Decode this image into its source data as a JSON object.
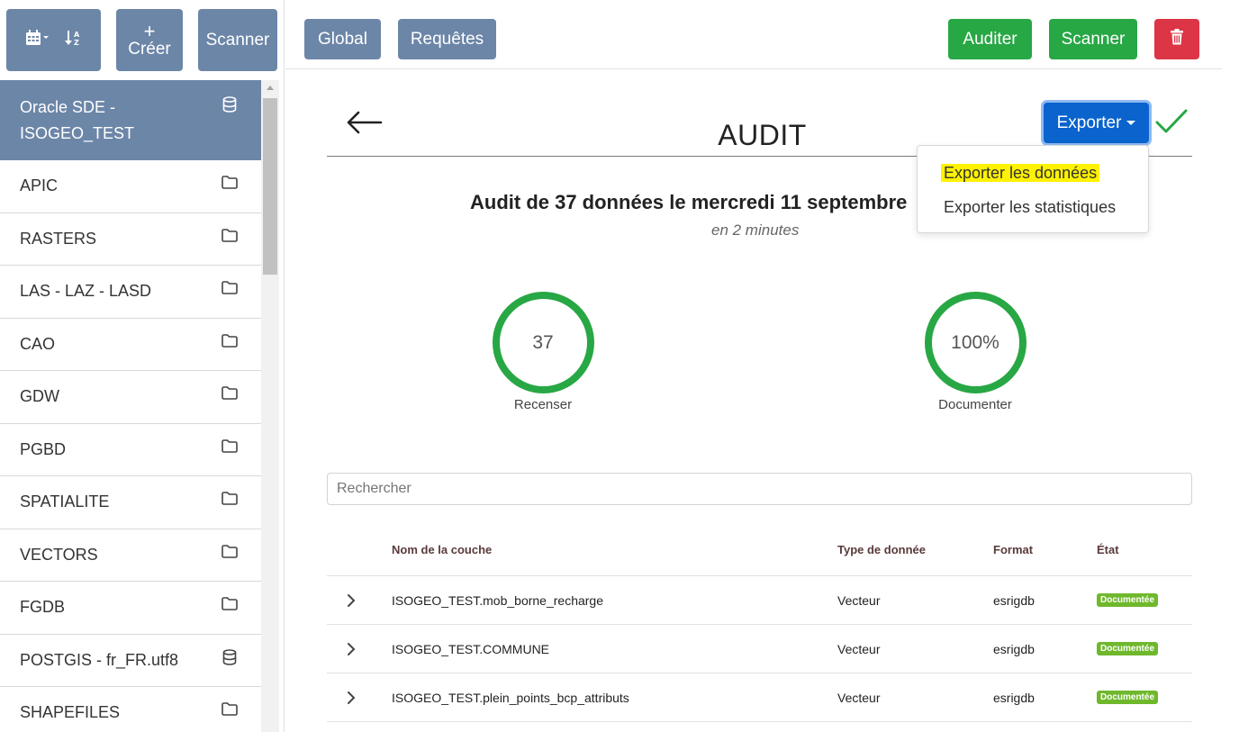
{
  "sidebar": {
    "toolbar": {
      "create_plus": "+",
      "create_label": "Créer",
      "scan_label": "Scanner",
      "calendar_icon": "calendar-icon",
      "sort_icon": "sort-alpha-icon"
    },
    "items": [
      {
        "label": "Oracle SDE - ISOGEO_TEST",
        "icon": "database-icon",
        "active": true
      },
      {
        "label": "APIC",
        "icon": "folder-icon"
      },
      {
        "label": "RASTERS",
        "icon": "folder-icon"
      },
      {
        "label": "LAS - LAZ - LASD",
        "icon": "folder-icon"
      },
      {
        "label": "CAO",
        "icon": "folder-icon"
      },
      {
        "label": "GDW",
        "icon": "folder-icon"
      },
      {
        "label": "PGBD",
        "icon": "folder-icon"
      },
      {
        "label": "SPATIALITE",
        "icon": "folder-icon"
      },
      {
        "label": "VECTORS",
        "icon": "folder-icon"
      },
      {
        "label": "FGDB",
        "icon": "folder-icon"
      },
      {
        "label": "POSTGIS - fr_FR.utf8",
        "icon": "database-icon"
      },
      {
        "label": "SHAPEFILES",
        "icon": "folder-icon"
      }
    ]
  },
  "topbar": {
    "global_label": "Global",
    "requests_label": "Requêtes",
    "audit_label": "Auditer",
    "scan_label": "Scanner",
    "delete_icon": "trash-icon"
  },
  "main": {
    "title": "AUDIT",
    "export_label": "Exporter",
    "dropdown": {
      "export_data": "Exporter les données",
      "export_stats": "Exporter les statistiques"
    },
    "summary": "Audit de 37 données le mercredi 11 septembre",
    "duration": "en 2 minutes",
    "stats": [
      {
        "value": "37",
        "label": "Recenser"
      },
      {
        "value": "100%",
        "label": "Documenter"
      }
    ],
    "search_placeholder": "Rechercher",
    "table": {
      "headers": {
        "name": "Nom de la couche",
        "type": "Type de donnée",
        "format": "Format",
        "state": "État"
      },
      "rows": [
        {
          "name": "ISOGEO_TEST.mob_borne_recharge",
          "type": "Vecteur",
          "format": "esrigdb",
          "state": "Documentée"
        },
        {
          "name": "ISOGEO_TEST.COMMUNE",
          "type": "Vecteur",
          "format": "esrigdb",
          "state": "Documentée"
        },
        {
          "name": "ISOGEO_TEST.plein_points_bcp_attributs",
          "type": "Vecteur",
          "format": "esrigdb",
          "state": "Documentée"
        }
      ]
    }
  },
  "colors": {
    "slate_blue": "#6c86a8",
    "green": "#28a745",
    "red": "#dc3545",
    "primary": "#0b63ce",
    "badge_green": "#6fb82c",
    "highlight": "#fff200"
  }
}
